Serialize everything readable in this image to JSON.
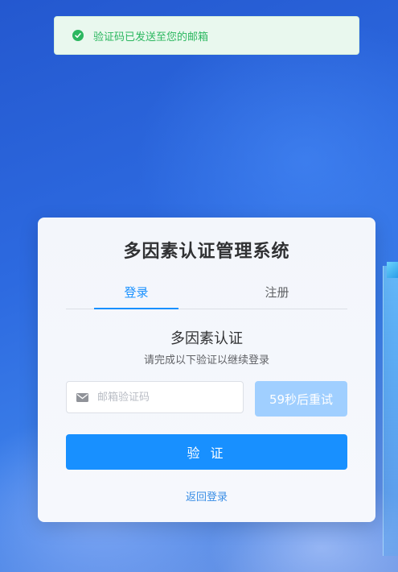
{
  "toast": {
    "message": "验证码已发送至您的邮箱",
    "icon": "check-circle-icon",
    "color": "#2bb75f"
  },
  "card": {
    "title": "多因素认证管理系统",
    "tabs": [
      {
        "label": "登录",
        "active": true
      },
      {
        "label": "注册",
        "active": false
      }
    ],
    "mfa_title": "多因素认证",
    "mfa_subtitle": "请完成以下验证以继续登录",
    "code_input": {
      "placeholder": "邮箱验证码",
      "value": "",
      "icon": "mail-icon"
    },
    "retry_button": "59秒后重试",
    "verify_button": "验 证",
    "back_link": "返回登录"
  },
  "colors": {
    "accent": "#1890ff",
    "retry_disabled": "#a0cfff",
    "success": "#2bb75f"
  }
}
